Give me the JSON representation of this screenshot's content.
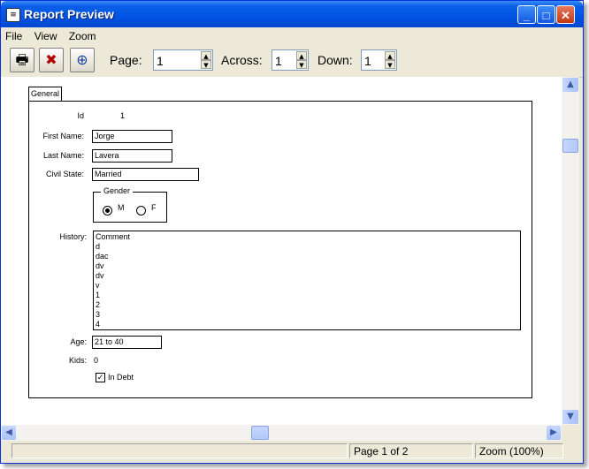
{
  "window": {
    "title": "Report Preview",
    "minimize": "_",
    "maximize": "□",
    "close": "✕"
  },
  "menu": [
    "File",
    "View",
    "Zoom"
  ],
  "toolbar": {
    "print_glyph": "🖶",
    "close_glyph": "✖",
    "zoom_glyph": "⊕",
    "page_label": "Page:",
    "page_value": "1",
    "across_label": "Across:",
    "across_value": "1",
    "down_label": "Down:",
    "down_value": "1"
  },
  "report": {
    "tab": "General",
    "fields": {
      "id_label": "Id",
      "id_value": "1",
      "first_name_label": "First Name:",
      "first_name_value": "Jorge",
      "last_name_label": "Last Name:",
      "last_name_value": "Lavera",
      "civil_state_label": "Civil State:",
      "civil_state_value": "Married",
      "gender_label": "Gender",
      "gender_m": "M",
      "gender_f": "F",
      "gender_selected": "M",
      "history_label": "History:",
      "history_lines": [
        "Comment",
        "d",
        "dac",
        "dv",
        "dv",
        "v",
        "1",
        "2",
        "3",
        "4"
      ],
      "age_label": "Age:",
      "age_value": "21 to 40",
      "kids_label": "Kids:",
      "kids_value": "0",
      "in_debt_label": "In Debt",
      "in_debt_checked": true
    }
  },
  "status": {
    "page_info": "Page 1 of 2",
    "zoom": "Zoom (100%)"
  }
}
